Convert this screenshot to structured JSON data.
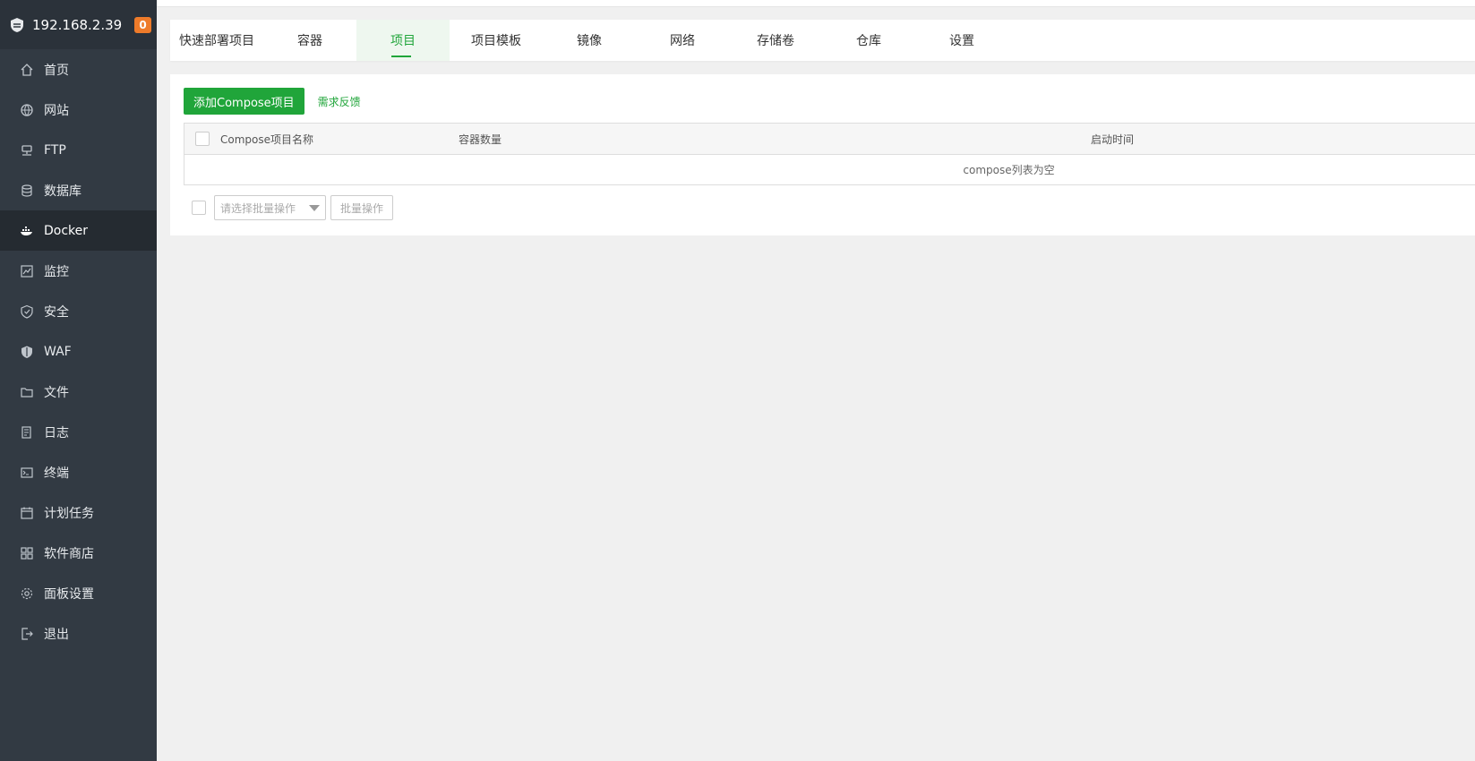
{
  "sidebar": {
    "host": "192.168.2.39",
    "badge": "0",
    "items": [
      {
        "label": "首页",
        "icon": "home-icon"
      },
      {
        "label": "网站",
        "icon": "globe-icon"
      },
      {
        "label": "FTP",
        "icon": "ftp-icon"
      },
      {
        "label": "数据库",
        "icon": "database-icon"
      },
      {
        "label": "Docker",
        "icon": "docker-icon",
        "active": true
      },
      {
        "label": "监控",
        "icon": "monitor-icon"
      },
      {
        "label": "安全",
        "icon": "shield-icon"
      },
      {
        "label": "WAF",
        "icon": "waf-shield-icon"
      },
      {
        "label": "文件",
        "icon": "folder-icon"
      },
      {
        "label": "日志",
        "icon": "log-icon"
      },
      {
        "label": "终端",
        "icon": "terminal-icon"
      },
      {
        "label": "计划任务",
        "icon": "calendar-icon"
      },
      {
        "label": "软件商店",
        "icon": "apps-grid-icon"
      },
      {
        "label": "面板设置",
        "icon": "gear-icon"
      },
      {
        "label": "退出",
        "icon": "logout-icon"
      }
    ]
  },
  "tabs": [
    {
      "label": "快速部署项目"
    },
    {
      "label": "容器"
    },
    {
      "label": "项目",
      "active": true
    },
    {
      "label": "项目模板"
    },
    {
      "label": "镜像"
    },
    {
      "label": "网络"
    },
    {
      "label": "存储卷"
    },
    {
      "label": "仓库"
    },
    {
      "label": "设置"
    }
  ],
  "toolbar": {
    "add_label": "添加Compose项目",
    "feedback_label": "需求反馈"
  },
  "table": {
    "headers": {
      "name": "Compose项目名称",
      "count": "容器数量",
      "time": "启动时间"
    },
    "empty_text": "compose列表为空"
  },
  "batch": {
    "placeholder": "请选择批量操作",
    "button_label": "批量操作"
  },
  "colors": {
    "accent": "#20a53a",
    "sidebar_bg": "#323a43",
    "badge": "#ee7b2a"
  }
}
